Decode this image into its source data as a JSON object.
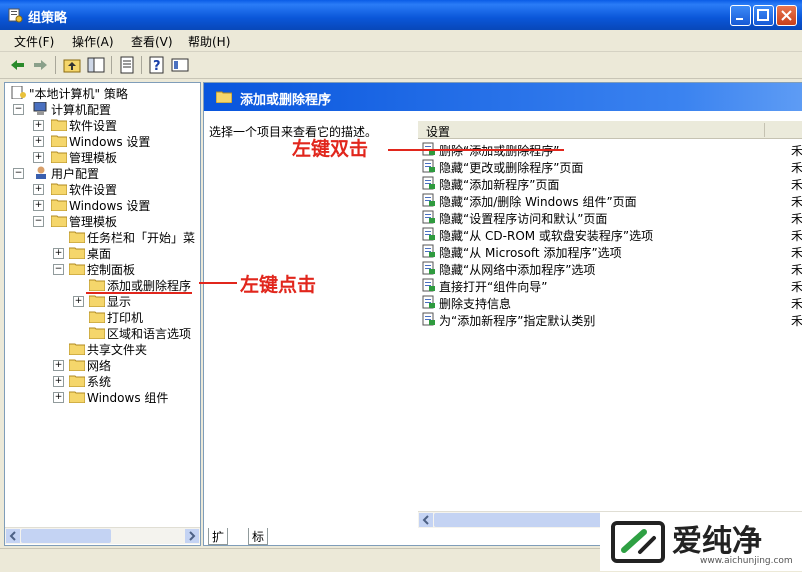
{
  "window": {
    "title": "组策略"
  },
  "menubar": {
    "items": [
      "文件(F)",
      "操作(A)",
      "查看(V)",
      "帮助(H)"
    ]
  },
  "tree": {
    "root": "\"本地计算机\" 策略",
    "computer_config": "计算机配置",
    "cc_children": [
      "软件设置",
      "Windows 设置",
      "管理模板"
    ],
    "user_config": "用户配置",
    "uc_children": [
      "软件设置",
      "Windows 设置",
      "管理模板"
    ],
    "admin_children": [
      "任务栏和「开始」菜",
      "桌面",
      "控制面板"
    ],
    "control_panel_children": [
      "添加或删除程序",
      "显示",
      "打印机",
      "区域和语言选项"
    ],
    "more_admin_children": [
      "共享文件夹",
      "网络",
      "系统",
      "Windows 组件"
    ]
  },
  "right": {
    "header_title": "添加或删除程序",
    "description": "选择一个项目来查看它的描述。",
    "column_setting": "设置",
    "trail_glyph": "禾",
    "items": [
      "删除“添加或删除程序”",
      "隐藏“更改或删除程序”页面",
      "隐藏“添加新程序”页面",
      "隐藏“添加/删除 Windows 组件”页面",
      "隐藏“设置程序访问和默认”页面",
      "隐藏“从 CD-ROM 或软盘安装程序”选项",
      "隐藏“从 Microsoft 添加程序”选项",
      "隐藏“从网络中添加程序”选项",
      "直接打开“组件向导”",
      "删除支持信息",
      "为“添加新程序”指定默认类别"
    ]
  },
  "tabs": [
    "扩展",
    "标准"
  ],
  "annotations": {
    "double_click": "左键双击",
    "click": "左键点击"
  },
  "watermark": {
    "text": "爱纯净",
    "url": "www.aichunjing.com"
  },
  "colors": {
    "accent": "#0a56d8",
    "annotation": "#e1261c",
    "folder": "#f5d66b"
  }
}
